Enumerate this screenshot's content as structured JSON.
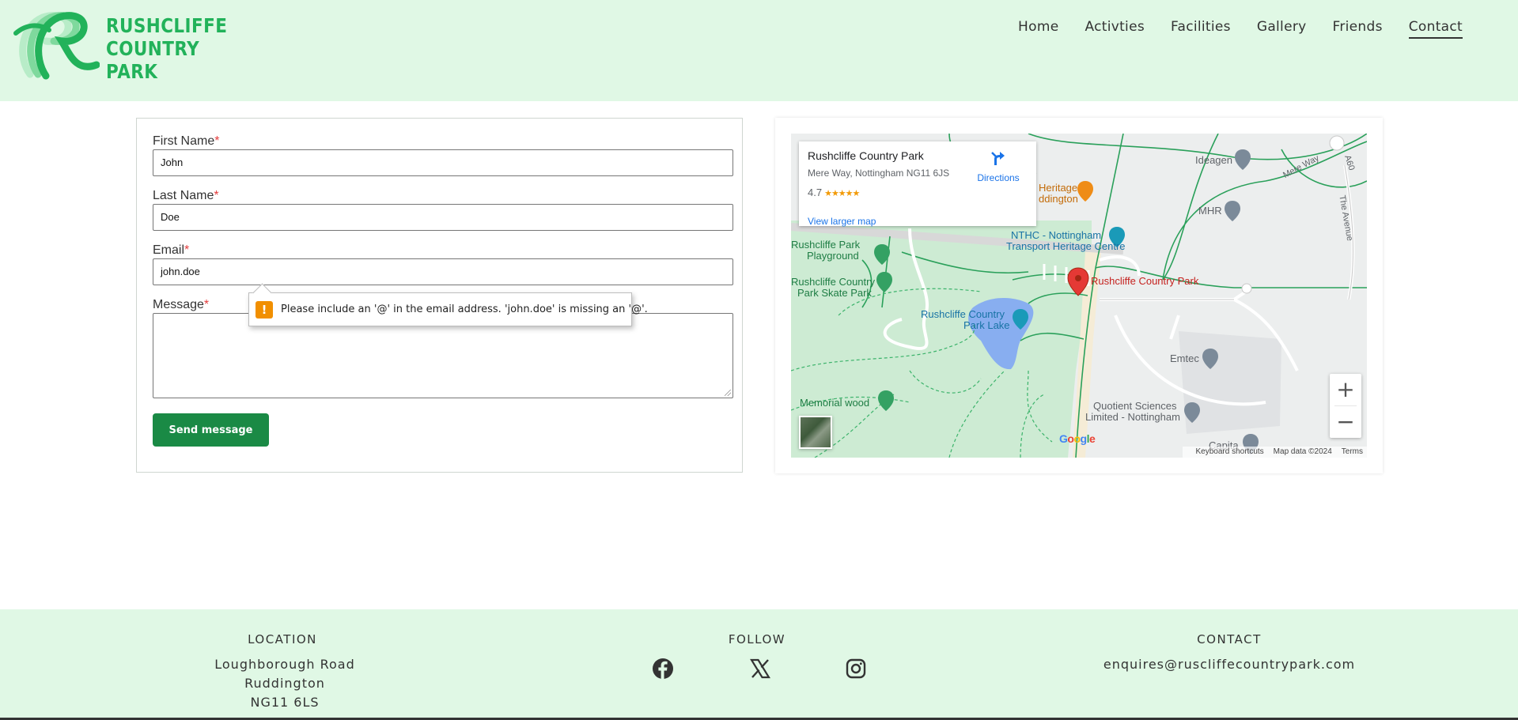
{
  "brand": {
    "line1": "RUSHCLIFFE",
    "line2": "COUNTRY",
    "line3": "PARK"
  },
  "nav": [
    {
      "label": "Home"
    },
    {
      "label": "Activties"
    },
    {
      "label": "Facilities"
    },
    {
      "label": "Gallery"
    },
    {
      "label": "Friends"
    },
    {
      "label": "Contact",
      "active": true
    }
  ],
  "form": {
    "first_name": {
      "label": "First Name",
      "required": "*",
      "value": "John"
    },
    "last_name": {
      "label": "Last Name",
      "required": "*",
      "value": "Doe"
    },
    "email": {
      "label": "Email",
      "required": "*",
      "value": "john.doe"
    },
    "message": {
      "label": "Message",
      "required": "*",
      "value": ""
    },
    "submit_label": "Send message",
    "validation_tooltip": {
      "icon": "!",
      "text": "Please include an '@' in the email address. 'john.doe' is missing an '@'."
    }
  },
  "map": {
    "place_name": "Rushcliffe Country Park",
    "address": "Mere Way, Nottingham NG11 6JS",
    "rating": "4.7",
    "stars": "★★★★★",
    "larger_map_link": "View larger map",
    "directions_label": "Directions",
    "labels": {
      "heritage_partial1": "Heritage",
      "heritage_partial2": "ddington",
      "ideagen": "Ideagen",
      "mhr": "MHR",
      "mere_way": "Mere Way",
      "a60": "A60",
      "the_avenue": "The Avenue",
      "nthc1": "NTHC - Nottingham",
      "nthc2": "Transport Heritage Centre",
      "playground1": "Rushcliffe Park",
      "playground2": "Playground",
      "skate1": "Rushcliffe Country",
      "skate2": "Park Skate Park",
      "lake1": "Rushcliffe Country",
      "lake2": "Park Lake",
      "pin_label": "Rushcliffe Country Park",
      "emtec": "Emtec",
      "quotient1": "Quotient Sciences",
      "quotient2": "Limited - Nottingham",
      "memorial": "Memorial wood",
      "capita": "Capita"
    },
    "google_logo": "Google",
    "zoom_in": "+",
    "zoom_out": "−",
    "attrib_shortcuts": "Keyboard shortcuts",
    "attrib_data": "Map data ©2024",
    "attrib_terms": "Terms"
  },
  "footer": {
    "location": {
      "heading": "LOCATION",
      "line1": "Loughborough Road",
      "line2": "Ruddington",
      "line3": "NG11 6LS"
    },
    "follow": {
      "heading": "FOLLOW",
      "icons": [
        "facebook-icon",
        "x-icon",
        "instagram-icon"
      ]
    },
    "contact": {
      "heading": "CONTACT",
      "email": "enquires@ruscliffecountrypark.com"
    }
  },
  "colors": {
    "header_bg": "#e0f8e5",
    "brand_green": "#22b25a",
    "button_green": "#1a8a45",
    "required_red": "#e53e3e",
    "warning_orange": "#f18f00"
  }
}
